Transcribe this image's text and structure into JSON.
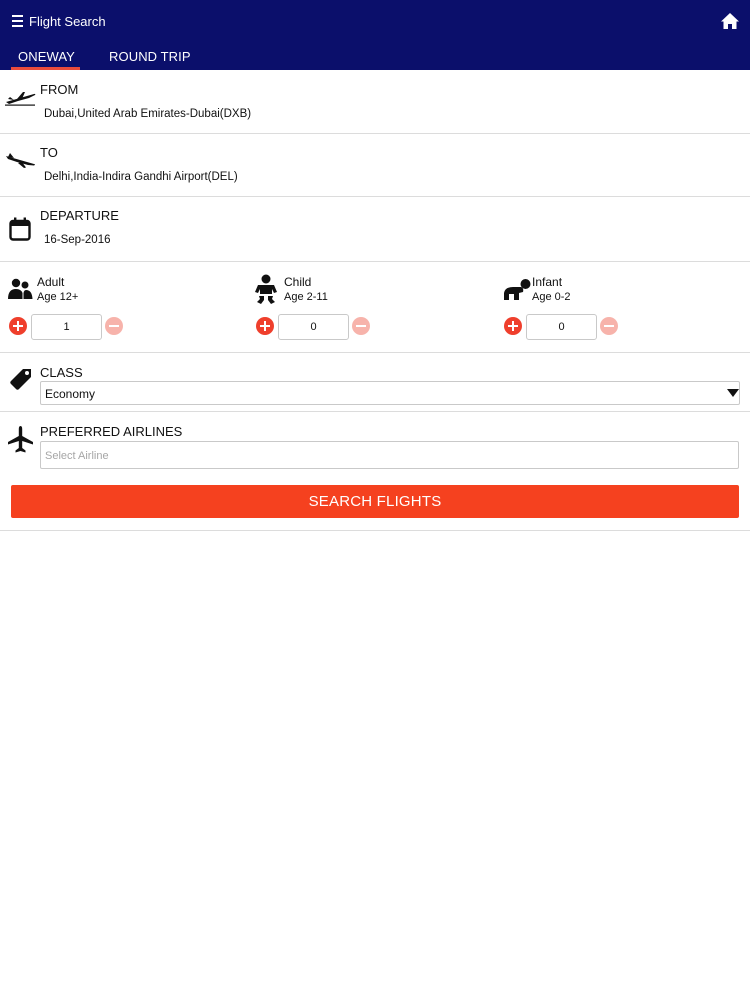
{
  "header": {
    "title": "Flight Search",
    "menu_icon": "hamburger-menu-icon",
    "home_icon": "home-icon",
    "bg_color": "#0b0f6b"
  },
  "tabs": [
    {
      "label": "ONEWAY",
      "active": true
    },
    {
      "label": "ROUND TRIP",
      "active": false
    }
  ],
  "from": {
    "label": "FROM",
    "value": "Dubai,United Arab Emirates-Dubai(DXB)",
    "icon": "plane-takeoff-icon"
  },
  "to": {
    "label": "TO",
    "value": "Delhi,India-Indira Gandhi Airport(DEL)",
    "icon": "plane-landing-icon"
  },
  "departure": {
    "label": "DEPARTURE",
    "value": "16-Sep-2016",
    "icon": "calendar-icon"
  },
  "passengers": [
    {
      "label": "Adult",
      "age": "Age 12+",
      "count": "1",
      "icon": "adult-icon"
    },
    {
      "label": "Child",
      "age": "Age 2-11",
      "count": "0",
      "icon": "child-icon"
    },
    {
      "label": "Infant",
      "age": "Age 0-2",
      "count": "0",
      "icon": "infant-icon"
    }
  ],
  "travel_class": {
    "label": "CLASS",
    "selected": "Economy",
    "icon": "tag-icon"
  },
  "airlines": {
    "label": "PREFERRED AIRLINES",
    "placeholder": "Select Airline",
    "icon": "airplane-icon"
  },
  "search_button": {
    "label": "SEARCH FLIGHTS",
    "color": "#f5411f"
  }
}
